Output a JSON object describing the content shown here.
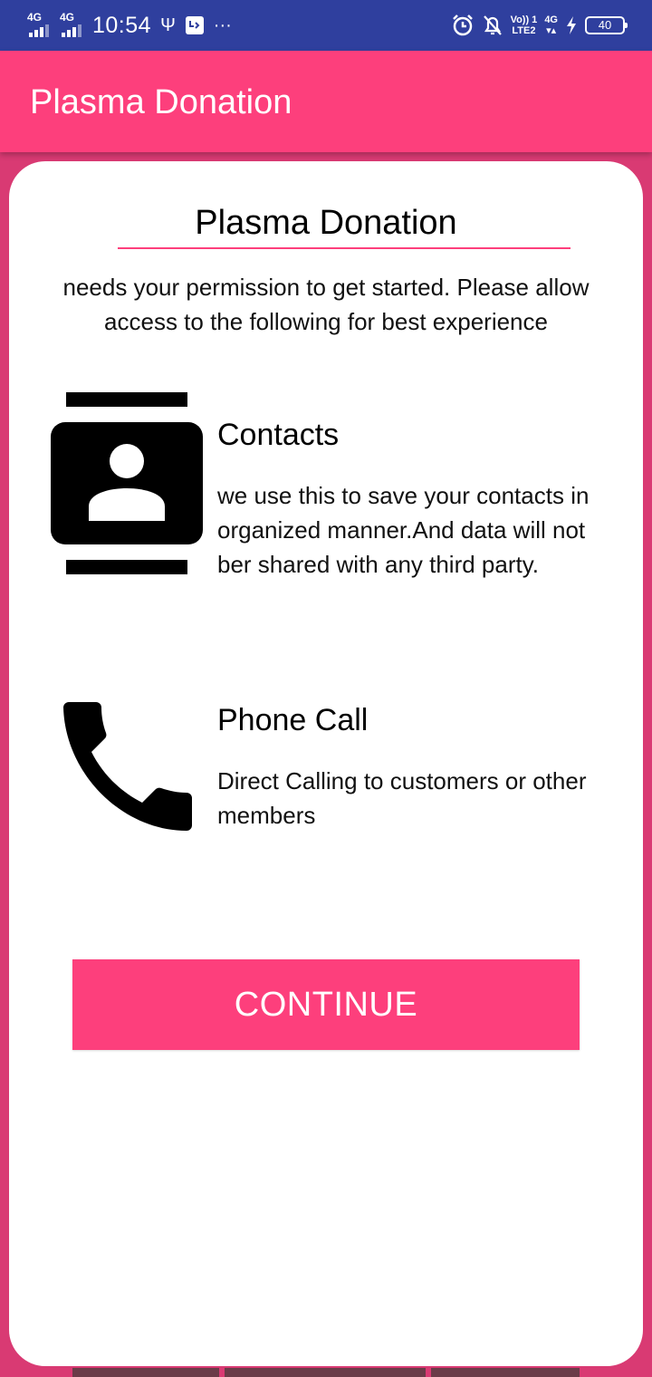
{
  "status_bar": {
    "net1": "4G",
    "net2": "4G",
    "time": "10:54",
    "usb_glyph": "Ψ",
    "more_glyph": "···",
    "volte_top": "Vo)) 1",
    "volte_bottom": "LTE2",
    "net3": "4G",
    "battery_level": "40"
  },
  "app_bar": {
    "title": "Plasma Donation"
  },
  "card": {
    "title": "Plasma Donation",
    "subtitle": "needs your permission to get started. Please allow access to the following for best experience",
    "permissions": [
      {
        "icon": "contacts-icon",
        "title": "Contacts",
        "description": "we use this to save your contacts in organized manner.And data will not ber shared with any third party."
      },
      {
        "icon": "phone-icon",
        "title": "Phone Call",
        "description": "Direct Calling to customers or other members"
      }
    ],
    "continue_label": "CONTINUE"
  },
  "colors": {
    "status_bar": "#2f3f9e",
    "accent": "#fd3f7c",
    "page_background": "#d93a73",
    "card": "#ffffff"
  }
}
